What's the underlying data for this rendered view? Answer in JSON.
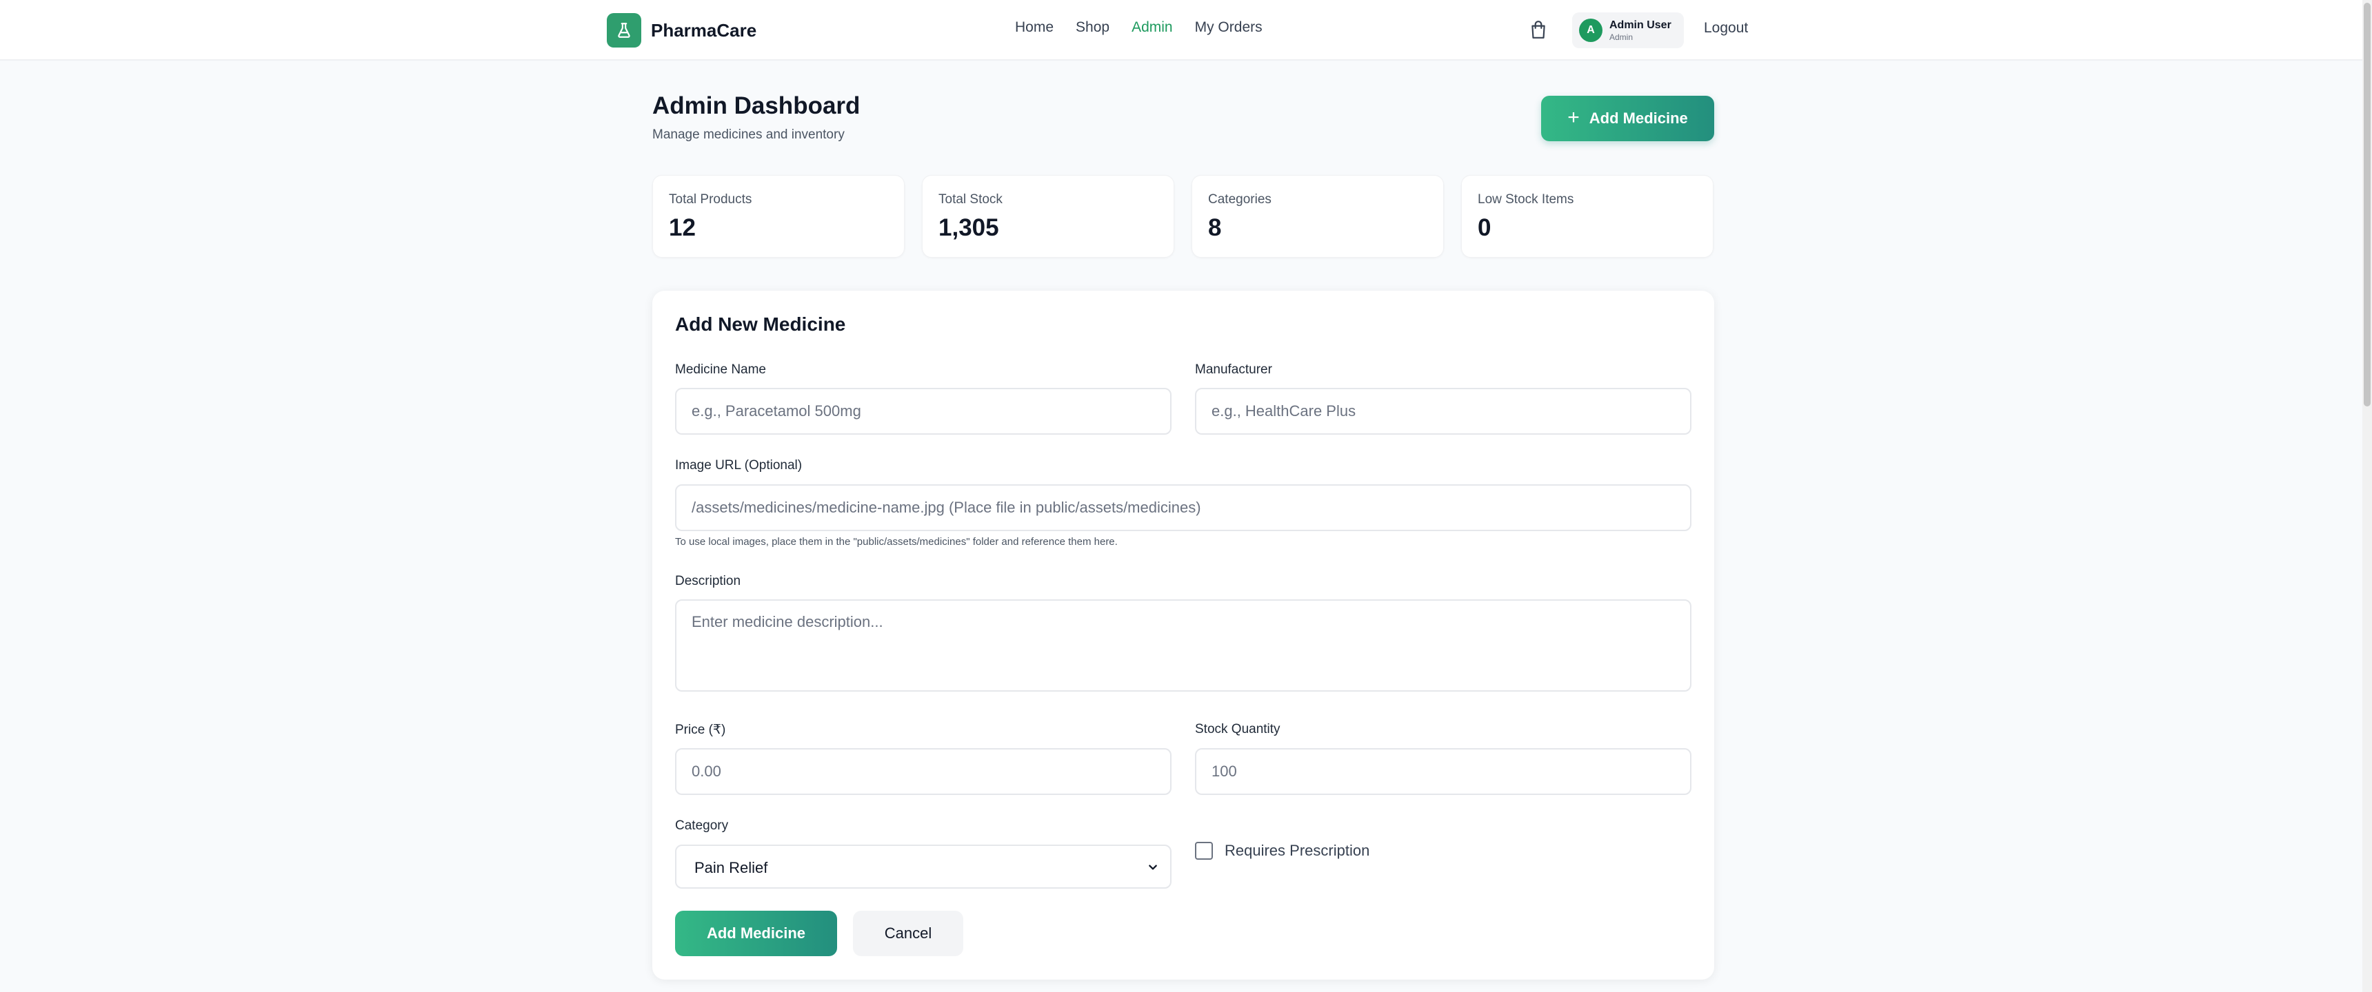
{
  "brand": {
    "name": "PharmaCare",
    "logo_icon": "flask-icon"
  },
  "nav": {
    "links": [
      {
        "label": "Home",
        "active": false
      },
      {
        "label": "Shop",
        "active": false
      },
      {
        "label": "Admin",
        "active": true
      },
      {
        "label": "My Orders",
        "active": false
      }
    ],
    "cart_icon": "shopping-bag-icon",
    "user": {
      "initial": "A",
      "name": "Admin User",
      "role": "Admin"
    },
    "logout_label": "Logout"
  },
  "header": {
    "title": "Admin Dashboard",
    "subtitle": "Manage medicines and inventory",
    "add_button_label": "Add Medicine",
    "add_button_icon": "plus-icon"
  },
  "stats": [
    {
      "label": "Total Products",
      "value": "12"
    },
    {
      "label": "Total Stock",
      "value": "1,305"
    },
    {
      "label": "Categories",
      "value": "8"
    },
    {
      "label": "Low Stock Items",
      "value": "0"
    }
  ],
  "form": {
    "title": "Add New Medicine",
    "medicine_name": {
      "label": "Medicine Name",
      "placeholder": "e.g., Paracetamol 500mg",
      "value": ""
    },
    "manufacturer": {
      "label": "Manufacturer",
      "placeholder": "e.g., HealthCare Plus",
      "value": ""
    },
    "image_url": {
      "label": "Image URL (Optional)",
      "placeholder": "/assets/medicines/medicine-name.jpg (Place file in public/assets/medicines)",
      "hint": "To use local images, place them in the \"public/assets/medicines\" folder and reference them here."
    },
    "description": {
      "label": "Description",
      "placeholder": "Enter medicine description..."
    },
    "price": {
      "label": "Price (₹)",
      "placeholder": "0.00"
    },
    "stock": {
      "label": "Stock Quantity",
      "placeholder": "100"
    },
    "category": {
      "label": "Category",
      "selected": "Pain Relief"
    },
    "prescription": {
      "label": "Requires Prescription",
      "checked": false
    },
    "submit_label": "Add Medicine",
    "cancel_label": "Cancel"
  },
  "colors": {
    "brand_green": "#2f9e6e",
    "active_link": "#1e9a5e",
    "button_gradient_start": "#34b886",
    "button_gradient_end": "#238f7e",
    "page_background": "#f8fafc"
  }
}
